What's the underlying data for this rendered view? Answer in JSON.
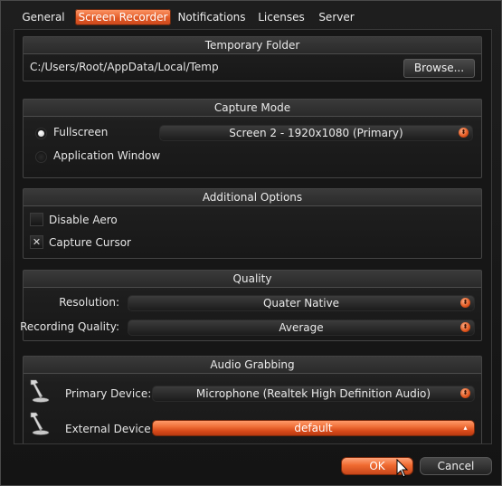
{
  "tabs": [
    {
      "label": "General",
      "active": false
    },
    {
      "label": "Screen Recorder",
      "active": true
    },
    {
      "label": "Notifications",
      "active": false
    },
    {
      "label": "Licenses",
      "active": false
    },
    {
      "label": "Server",
      "active": false
    }
  ],
  "temporary_folder": {
    "title": "Temporary Folder",
    "path": "C:/Users/Root/AppData/Local/Temp",
    "browse_label": "Browse..."
  },
  "capture_mode": {
    "title": "Capture Mode",
    "options": [
      {
        "label": "Fullscreen",
        "selected": true
      },
      {
        "label": "Application Window",
        "selected": false
      }
    ],
    "screen_select": "Screen 2 - 1920x1080 (Primary)"
  },
  "additional_options": {
    "title": "Additional Options",
    "disable_aero": {
      "label": "Disable Aero",
      "checked": false
    },
    "capture_cursor": {
      "label": "Capture Cursor",
      "checked": true,
      "mark": "✕"
    }
  },
  "quality": {
    "title": "Quality",
    "resolution_label": "Resolution:",
    "resolution_value": "Quater Native",
    "recording_quality_label": "Recording Quality:",
    "recording_quality_value": "Average"
  },
  "audio_grabbing": {
    "title": "Audio Grabbing",
    "primary_label": "Primary Device:",
    "primary_value": "Microphone (Realtek High Definition Audio)",
    "external_label": "External Device:",
    "external_value": "default"
  },
  "dialog": {
    "ok_label": "OK",
    "cancel_label": "Cancel"
  },
  "icons": {
    "dropdown_arrow": "⬍",
    "microphone": "microphone-icon",
    "cursor": "mouse-pointer-icon"
  },
  "colors": {
    "accent": "#f06a30",
    "background": "#161616"
  }
}
